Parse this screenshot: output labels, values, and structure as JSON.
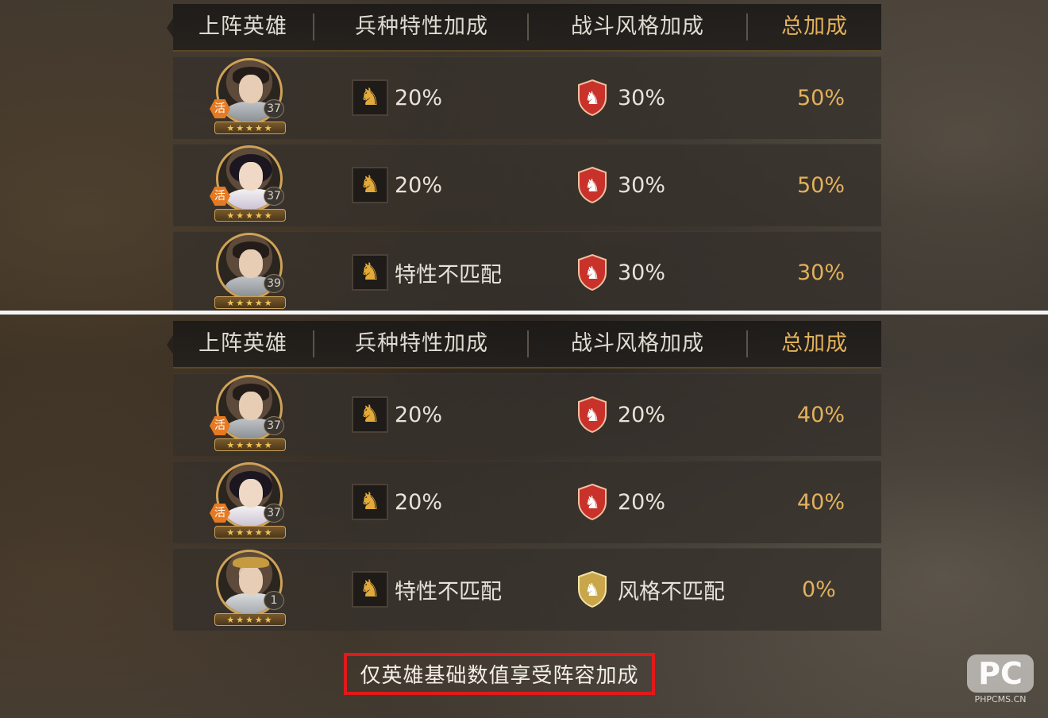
{
  "header": {
    "col_hero": "上阵英雄",
    "col_troop": "兵种特性加成",
    "col_style": "战斗风格加成",
    "col_total": "总加成"
  },
  "colors": {
    "gold": "#e3b15c",
    "red_highlight": "#e01a1a",
    "tag_orange": "#e57a22"
  },
  "panel_top": {
    "rows": [
      {
        "hero_icon": "male-general-portrait",
        "tag": "活",
        "level": "37",
        "stars": "★★★★★",
        "troop_icon": "horse-icon",
        "troop": "20%",
        "style_icon": "red-lion-shield-icon",
        "style": "30%",
        "total": "50%"
      },
      {
        "hero_icon": "female-general-portrait",
        "tag": "活",
        "level": "37",
        "stars": "★★★★★",
        "troop_icon": "horse-icon",
        "troop": "20%",
        "style_icon": "red-lion-shield-icon",
        "style": "30%",
        "total": "50%"
      },
      {
        "hero_icon": "male-warrior-portrait",
        "tag": "",
        "level": "39",
        "stars": "★★★★★",
        "troop_icon": "horse-icon",
        "troop": "特性不匹配",
        "style_icon": "red-lion-shield-icon",
        "style": "30%",
        "total": "30%"
      }
    ]
  },
  "panel_bottom": {
    "rows": [
      {
        "hero_icon": "male-general-portrait",
        "tag": "活",
        "level": "37",
        "stars": "★★★★★",
        "troop_icon": "horse-icon",
        "troop": "20%",
        "style_icon": "red-lion-shield-icon",
        "style": "20%",
        "total": "40%"
      },
      {
        "hero_icon": "female-general-portrait",
        "tag": "活",
        "level": "37",
        "stars": "★★★★★",
        "troop_icon": "horse-icon",
        "troop": "20%",
        "style_icon": "red-lion-shield-icon",
        "style": "20%",
        "total": "40%"
      },
      {
        "hero_icon": "crowned-king-portrait",
        "tag": "",
        "level": "1",
        "stars": "★★★★★",
        "troop_icon": "horse-icon",
        "troop": "特性不匹配",
        "style_icon": "gold-lion-shield-icon",
        "style": "风格不匹配",
        "total": "0%"
      }
    ]
  },
  "note": "仅英雄基础数值享受阵容加成",
  "watermark": {
    "logo": "PC",
    "text": "PHPCMS.CN"
  }
}
